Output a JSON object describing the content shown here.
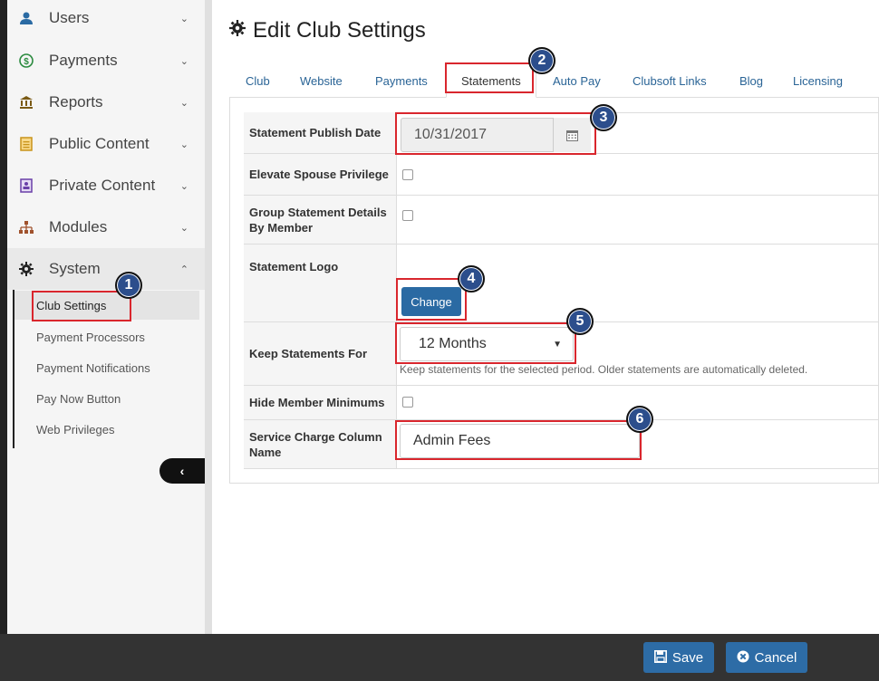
{
  "sidebar": {
    "items": [
      {
        "label": "Users",
        "icon": "user-icon"
      },
      {
        "label": "Payments",
        "icon": "dollar-circle-icon"
      },
      {
        "label": "Reports",
        "icon": "bank-icon"
      },
      {
        "label": "Public Content",
        "icon": "document-icon"
      },
      {
        "label": "Private Content",
        "icon": "locked-document-icon"
      },
      {
        "label": "Modules",
        "icon": "sitemap-icon"
      },
      {
        "label": "System",
        "icon": "gear-icon"
      }
    ],
    "submenu": [
      {
        "label": "Club Settings"
      },
      {
        "label": "Payment Processors"
      },
      {
        "label": "Payment Notifications"
      },
      {
        "label": "Pay Now Button"
      },
      {
        "label": "Web Privileges"
      }
    ],
    "collapse_glyph": "‹"
  },
  "page": {
    "title": "Edit Club Settings",
    "tabs": [
      {
        "label": "Club"
      },
      {
        "label": "Website"
      },
      {
        "label": "Payments"
      },
      {
        "label": "Statements"
      },
      {
        "label": "Auto Pay"
      },
      {
        "label": "Clubsoft Links"
      },
      {
        "label": "Blog"
      },
      {
        "label": "Licensing"
      }
    ]
  },
  "form": {
    "publish_date_label": "Statement Publish Date",
    "publish_date_value": "10/31/2017",
    "elevate_spouse_label": "Elevate Spouse Privilege",
    "group_details_label": "Group Statement Details By Member",
    "logo_label": "Statement Logo",
    "change_button": "Change",
    "keep_label": "Keep Statements For",
    "keep_value": "12 Months",
    "keep_help": "Keep statements for the selected period. Older statements are automatically deleted.",
    "hide_minimums_label": "Hide Member Minimums",
    "service_charge_label": "Service Charge Column Name",
    "service_charge_value": "Admin Fees"
  },
  "callouts": [
    "1",
    "2",
    "3",
    "4",
    "5",
    "6"
  ],
  "footer": {
    "save_label": "Save",
    "cancel_label": "Cancel"
  },
  "colors": {
    "primary": "#2d6ca6",
    "highlight": "#d9262d",
    "callout": "#2c4e8c"
  }
}
